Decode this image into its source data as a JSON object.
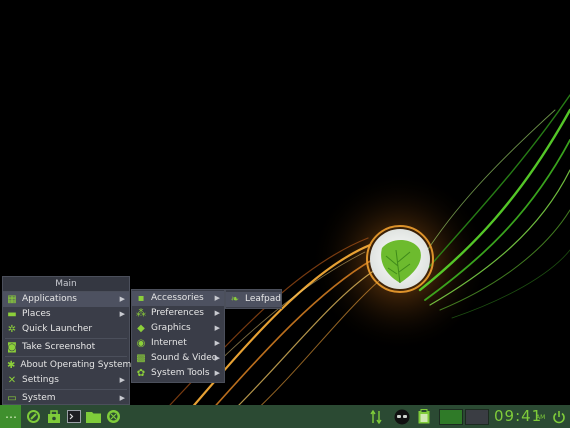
{
  "menu": {
    "header": "Main",
    "items": [
      {
        "label": "Applications",
        "icon": "applications-icon",
        "arrow": true
      },
      {
        "label": "Places",
        "icon": "places-folder-icon",
        "arrow": true
      },
      {
        "label": "Quick Launcher",
        "icon": "quick-launcher-icon",
        "arrow": false
      },
      {
        "label": "Take Screenshot",
        "icon": "camera-icon",
        "arrow": false
      },
      {
        "label": "About Operating System",
        "icon": "info-icon",
        "arrow": false
      },
      {
        "label": "Settings",
        "icon": "settings-icon",
        "arrow": true
      },
      {
        "label": "System",
        "icon": "system-icon",
        "arrow": true
      }
    ]
  },
  "applications_menu": {
    "items": [
      {
        "label": "Accessories",
        "icon": "accessories-icon"
      },
      {
        "label": "Preferences",
        "icon": "preferences-icon"
      },
      {
        "label": "Graphics",
        "icon": "graphics-icon"
      },
      {
        "label": "Internet",
        "icon": "internet-icon"
      },
      {
        "label": "Sound & Video",
        "icon": "sound-video-icon"
      },
      {
        "label": "System Tools",
        "icon": "system-tools-icon"
      }
    ]
  },
  "accessories_menu": {
    "items": [
      {
        "label": "Leafpad",
        "icon": "leafpad-icon"
      }
    ]
  },
  "taskbar": {
    "clock": "09:41",
    "ampm": "AM",
    "launchers": [
      "start-menu-icon",
      "browser-icon",
      "software-center-icon",
      "terminal-icon",
      "file-manager-icon",
      "settings-app-icon"
    ],
    "tray": [
      "network-arrows-icon",
      "monitor-face-icon",
      "clipboard-icon",
      "power-icon"
    ]
  },
  "colors": {
    "accent": "#7fcc3a",
    "menu_bg": "#3a3d48",
    "taskbar_bg": "#2b4a33"
  }
}
